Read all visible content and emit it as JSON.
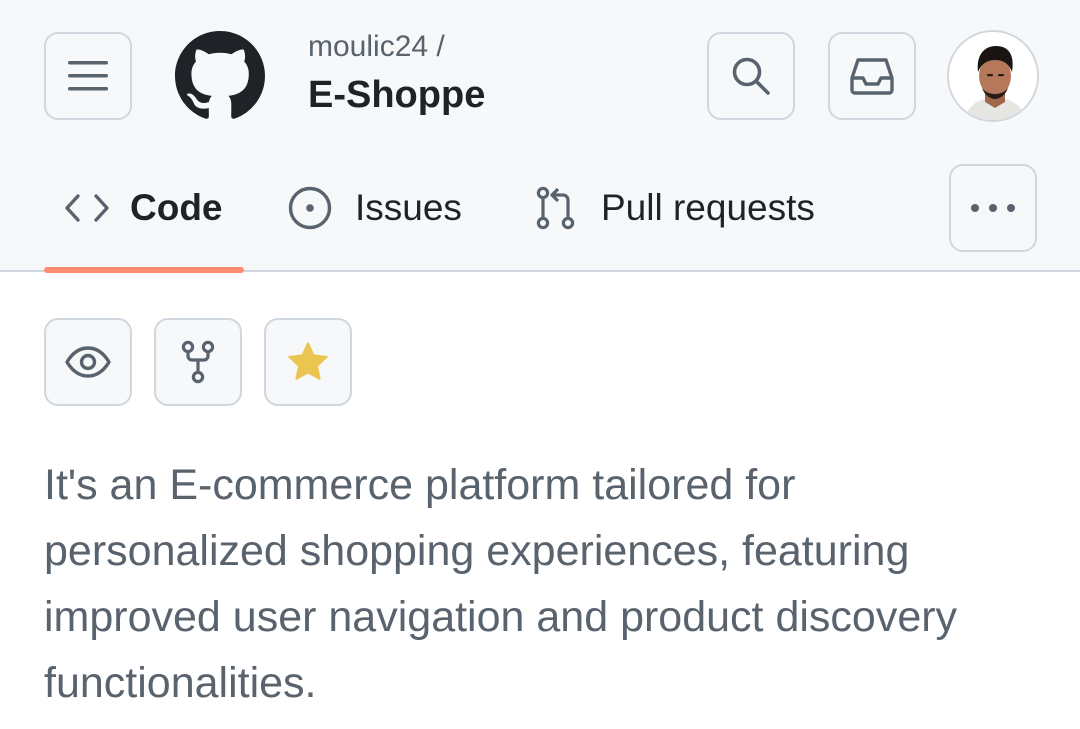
{
  "header": {
    "owner": "moulic24 /",
    "repo_name": "E-Shoppe",
    "icons": {
      "menu": "hamburger-menu-icon",
      "logo": "github-logo-icon",
      "search": "search-icon",
      "inbox": "inbox-icon",
      "avatar": "user-avatar"
    }
  },
  "tabs": [
    {
      "label": "Code",
      "icon": "code-icon",
      "selected": true
    },
    {
      "label": "Issues",
      "icon": "issue-opened-icon",
      "selected": false
    },
    {
      "label": "Pull requests",
      "icon": "git-pull-request-icon",
      "selected": false
    }
  ],
  "more_icon": "kebab-horizontal-icon",
  "actions": {
    "watch_icon": "eye-icon",
    "fork_icon": "repo-forked-icon",
    "star_icon": "star-fill-icon"
  },
  "description": "It's an E-commerce platform tailored for personalized shopping experiences, featuring improved user navigation and product discovery functionalities.",
  "colors": {
    "header_bg": "#f6f8fa",
    "border": "#d0d7de",
    "selected_tab_underline": "#fd8c73",
    "star": "#eac54f",
    "text_primary": "#1f2328",
    "text_muted": "#59636e"
  }
}
